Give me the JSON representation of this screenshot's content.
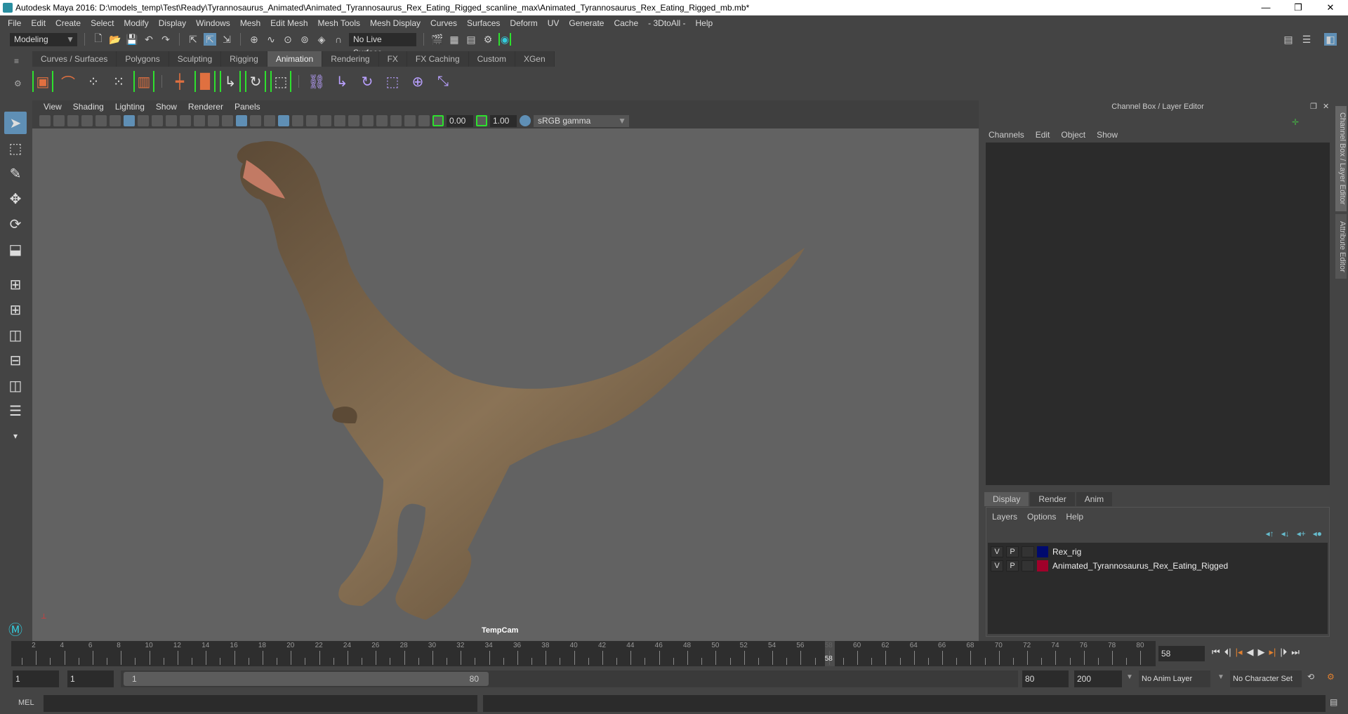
{
  "window": {
    "title": "Autodesk Maya 2016: D:\\models_temp\\Test\\Ready\\Tyrannosaurus_Animated\\Animated_Tyrannosaurus_Rex_Eating_Rigged_scanline_max\\Animated_Tyrannosaurus_Rex_Eating_Rigged_mb.mb*",
    "minimize": "—",
    "restore": "❐",
    "close": "✕"
  },
  "menubar": [
    "File",
    "Edit",
    "Create",
    "Select",
    "Modify",
    "Display",
    "Windows",
    "Mesh",
    "Edit Mesh",
    "Mesh Tools",
    "Mesh Display",
    "Curves",
    "Surfaces",
    "Deform",
    "UV",
    "Generate",
    "Cache",
    "- 3DtoAll -",
    "Help"
  ],
  "statusline": {
    "mode": "Modeling",
    "live_surface": "No Live Surface"
  },
  "shelf": {
    "tabs": [
      "Curves / Surfaces",
      "Polygons",
      "Sculpting",
      "Rigging",
      "Animation",
      "Rendering",
      "FX",
      "FX Caching",
      "Custom",
      "XGen"
    ],
    "active": "Animation"
  },
  "viewport": {
    "menus": [
      "View",
      "Shading",
      "Lighting",
      "Show",
      "Renderer",
      "Panels"
    ],
    "exposure": "0.00",
    "gamma": "1.00",
    "color_space": "sRGB gamma",
    "camera": "TempCam"
  },
  "channel_box": {
    "title": "Channel Box / Layer Editor",
    "menus": [
      "Channels",
      "Edit",
      "Object",
      "Show"
    ]
  },
  "layer_editor": {
    "tabs": [
      "Display",
      "Render",
      "Anim"
    ],
    "active": "Display",
    "menus": [
      "Layers",
      "Options",
      "Help"
    ],
    "layers": [
      {
        "v": "V",
        "p": "P",
        "name": "Rex_rig",
        "color": "#000a6e"
      },
      {
        "v": "V",
        "p": "P",
        "name": "Animated_Tyrannosaurus_Rex_Eating_Rigged",
        "color": "#a0002a"
      }
    ]
  },
  "side_tabs": [
    "Channel Box / Layer Editor",
    "Attribute Editor"
  ],
  "timeline": {
    "ticks": [
      "2",
      "4",
      "6",
      "8",
      "10",
      "12",
      "14",
      "16",
      "18",
      "20",
      "22",
      "24",
      "26",
      "28",
      "30",
      "32",
      "34",
      "36",
      "38",
      "40",
      "42",
      "44",
      "46",
      "48",
      "50",
      "52",
      "54",
      "56",
      "58",
      "60",
      "62",
      "64",
      "66",
      "68",
      "70",
      "72",
      "74",
      "76",
      "78",
      "80"
    ],
    "current_frame": "58",
    "start": 1,
    "end": 80
  },
  "range": {
    "start": "1",
    "playback_start": "1",
    "slider_start": "1",
    "slider_end": "80",
    "playback_end": "80",
    "end": "200",
    "anim_layer": "No Anim Layer",
    "character_set": "No Character Set"
  },
  "command_line": {
    "label": "MEL"
  }
}
